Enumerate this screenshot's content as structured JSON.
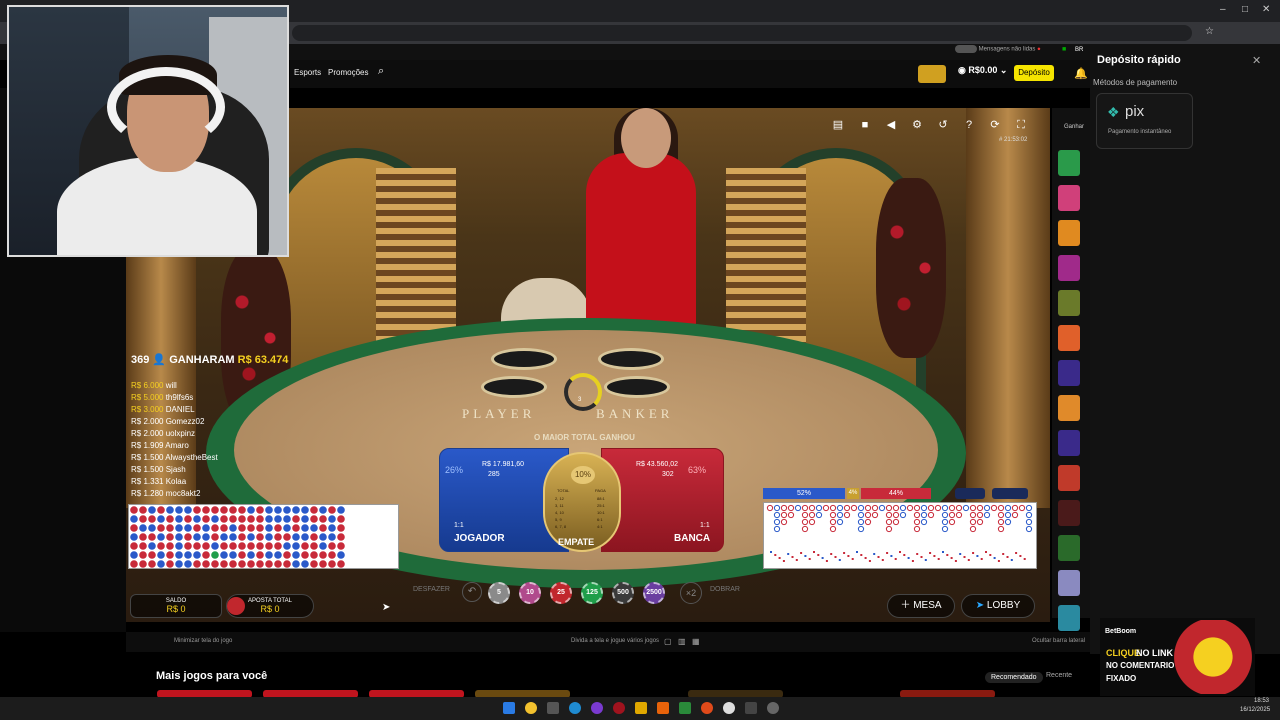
{
  "window": {
    "minimize": "–",
    "maximize": "□",
    "close": "✕"
  },
  "topnav": {
    "esports": "Esports",
    "promocoes": "Promoções",
    "balance": "R$0.00",
    "deposit_label": "Depósito",
    "messages": "Mensagens não lidas",
    "lang": "BR"
  },
  "deposit_panel": {
    "title": "Depósito rápido",
    "methods_label": "Métodos de pagamento",
    "pix_name": "pix",
    "pix_sub": "Pagamento instantâneo"
  },
  "game": {
    "timestamp": "# 21:53:02",
    "winners_count": "369",
    "winners_label": "GANHARAM",
    "winners_amount": "R$ 63.474",
    "winners": [
      {
        "amount": "R$ 6.000",
        "name": "will"
      },
      {
        "amount": "R$ 5.000",
        "name": "th9lfs6s"
      },
      {
        "amount": "R$ 3.000",
        "name": "DANIEL"
      },
      {
        "amount": "R$ 2.000",
        "name": "Gomezz02"
      },
      {
        "amount": "R$ 2.000",
        "name": "uolxpinz"
      },
      {
        "amount": "R$ 1.909",
        "name": "Amaro"
      },
      {
        "amount": "R$ 1.500",
        "name": "AlwaystheBest"
      },
      {
        "amount": "R$ 1.500",
        "name": "Sjash"
      },
      {
        "amount": "R$ 1.331",
        "name": "Kolaa"
      },
      {
        "amount": "R$ 1.280",
        "name": "moc8akt2"
      }
    ],
    "table_player": "PLAYER",
    "table_banker": "BANKER",
    "round": "3",
    "maior_total": "O MAIOR TOTAL GANHOU",
    "player": {
      "pct": "26%",
      "amount": "R$ 17.981,60",
      "count": "285",
      "odds": "1:1",
      "label": "JOGADOR"
    },
    "banker": {
      "pct": "63%",
      "amount": "R$ 43.560,02",
      "count": "302",
      "odds": "1:1",
      "label": "BANCA"
    },
    "tie": {
      "pct": "10%",
      "label": "EMPATE",
      "col1": "TOTAL",
      "col2": "PAGA",
      "rows": [
        [
          "2, 12",
          "88:1"
        ],
        [
          "3, 11",
          "25:1"
        ],
        [
          "4, 10",
          "10:1"
        ],
        [
          "5, 9",
          "6:1"
        ],
        [
          "6, 7, 8",
          "4:1"
        ]
      ]
    },
    "stats": {
      "player": "52%",
      "tie": "4%",
      "banker": "44%"
    },
    "saldo_label": "SALDO",
    "saldo": "R$ 0",
    "aposta_label": "APOSTA TOTAL",
    "aposta": "R$ 0",
    "desfazer": "DESFAZER",
    "dobrar": "DOBRAR",
    "x2": "×2",
    "chips": [
      "5",
      "10",
      "25",
      "125",
      "500",
      "2500"
    ],
    "mesa": "MESA",
    "lobby": "LOBBY",
    "ganhar_tab": "Ganhar"
  },
  "colors": {
    "chip_5": "#8a8a8a",
    "chip_10": "#b04a8c",
    "chip_25": "#c1272d",
    "chip_125": "#1f9e4a",
    "chip_500": "#3a3a3a",
    "chip_2500": "#6a3ea0",
    "player": "#2a59c9",
    "banker": "#c82a3a",
    "deposit": "#f5e400"
  },
  "gamebar": {
    "minimize": "Minimizar tela do jogo",
    "split": "Divida a tela e jogue vários jogos",
    "hide": "Ocultar barra lateral"
  },
  "more": {
    "title": "Mais jogos para você",
    "recomendado": "Recomendado",
    "recente": "Recente"
  },
  "promo": {
    "brand": "BetBoom",
    "line1": "CLIQUE",
    "line2": "NO LINK",
    "line3": "NO COMENTARIO",
    "line4": "FIXADO"
  },
  "clock": {
    "time": "18:53",
    "date": "16/12/2025"
  },
  "road_left": [
    "BBPBPPPBBBBBBPBPPPPPBPBP",
    "PBBPBPBPBPBBBBBPPPBPBBPB",
    "BPPBBPPBPBBPBBBPBPBPPBPB",
    "PBBPBPBPPBPPBPBPBBPPBPPB",
    "BBPBBPBBBPBBBBBBBPPBBPBB",
    "PBBPBPPPBTPPBPBPPBPBBBBP",
    "BBBPBPPBBBBBBBBBBBPPBBBB"
  ]
}
